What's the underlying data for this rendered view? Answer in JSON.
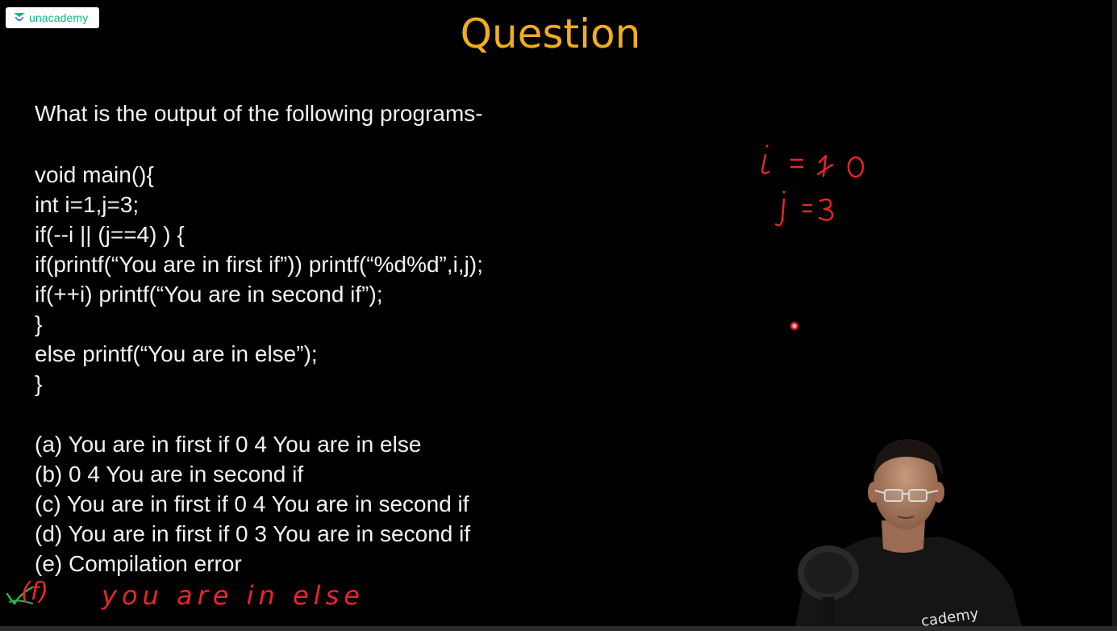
{
  "brand": {
    "logo_text": "unacademy",
    "logo_icon": "unacademy-logo-icon",
    "color": "#08bd80"
  },
  "slide": {
    "title": "Question",
    "title_color": "#f0ad1f",
    "question": "What is the output of the following programs-",
    "code": [
      "void main(){",
      "int i=1,j=3;",
      "if(--i || (j==4) ) {",
      "if(printf(“You are in first if”)) printf(“%d%d”,i,j);",
      "if(++i) printf(“You are in second if”);",
      "}",
      "else printf(“You are in else”);",
      "}"
    ],
    "options": [
      "(a) You are in first if 0 4 You are in else",
      "(b) 0 4 You are in second if",
      "(c) You are in first if 0 4 You are in second if",
      "(d) You are in first if 0 3 You are in second if",
      "(e) Compilation error"
    ]
  },
  "annotations": {
    "ink_color": "#e8262a",
    "check_color": "#2fb84a",
    "i_note": "i = 1 0",
    "j_note": "j = 3",
    "answer_label": "(f)",
    "answer_text": "you are in else"
  },
  "webcam": {
    "shirt_text": "cademy"
  }
}
